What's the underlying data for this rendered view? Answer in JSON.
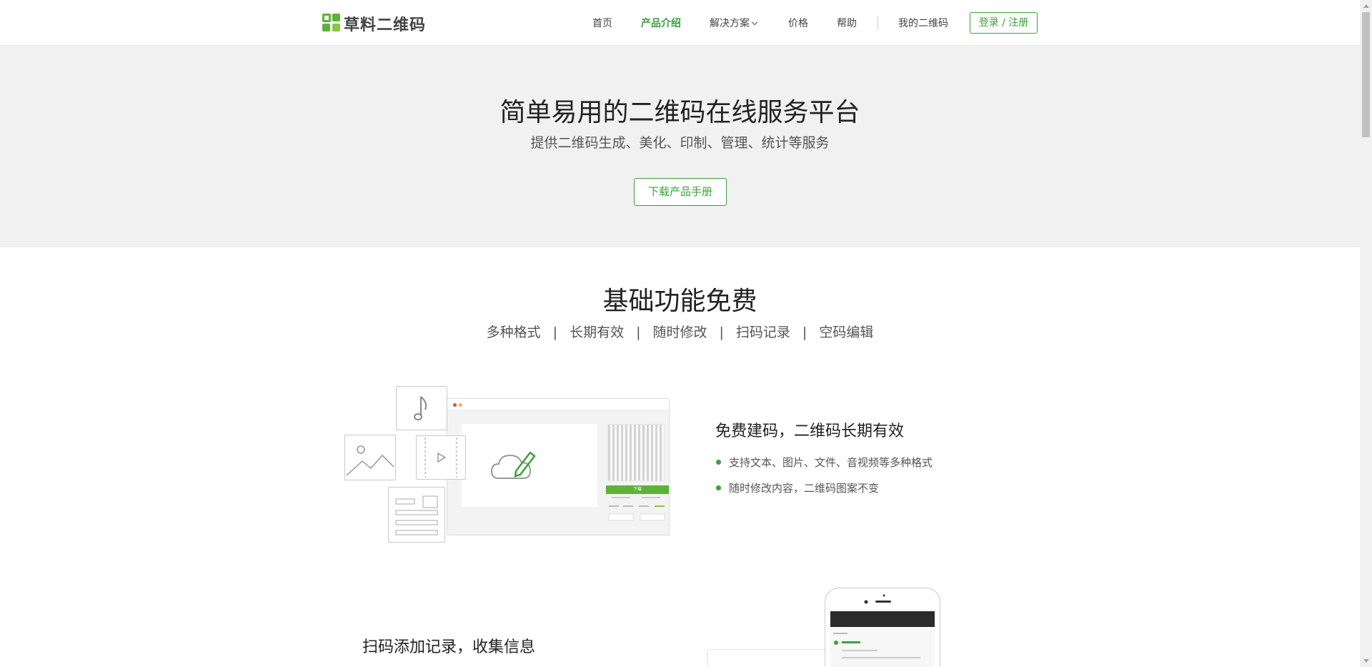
{
  "header": {
    "logo_text": "草料二维码",
    "nav": {
      "home": "首页",
      "product": "产品介绍",
      "solutions": "解决方案",
      "pricing": "价格",
      "help": "帮助",
      "my_qr": "我的二维码"
    },
    "login_label": "登录 / 注册"
  },
  "hero": {
    "title": "简单易用的二维码在线服务平台",
    "subtitle": "提供二维码生成、美化、印制、管理、统计等服务",
    "download_label": "下载产品手册"
  },
  "section": {
    "title": "基础功能免费",
    "features": [
      "多种格式",
      "长期有效",
      "随时修改",
      "扫码记录",
      "空码编辑"
    ],
    "separator": "|"
  },
  "block1": {
    "title": "免费建码，二维码长期有效",
    "bullets": [
      "支持文本、图片、文件、音视频等多种格式",
      "随时修改内容，二维码图案不变"
    ],
    "illus_button": "下载"
  },
  "block2": {
    "title": "扫码添加记录，收集信息"
  },
  "colors": {
    "accent": "#3aa23a",
    "hero_bg": "#f1f1f1"
  },
  "icons": [
    "music-note-icon",
    "image-icon",
    "video-icon",
    "document-icon",
    "cloud-edit-icon",
    "qr-code-icon",
    "chevron-down-icon"
  ]
}
